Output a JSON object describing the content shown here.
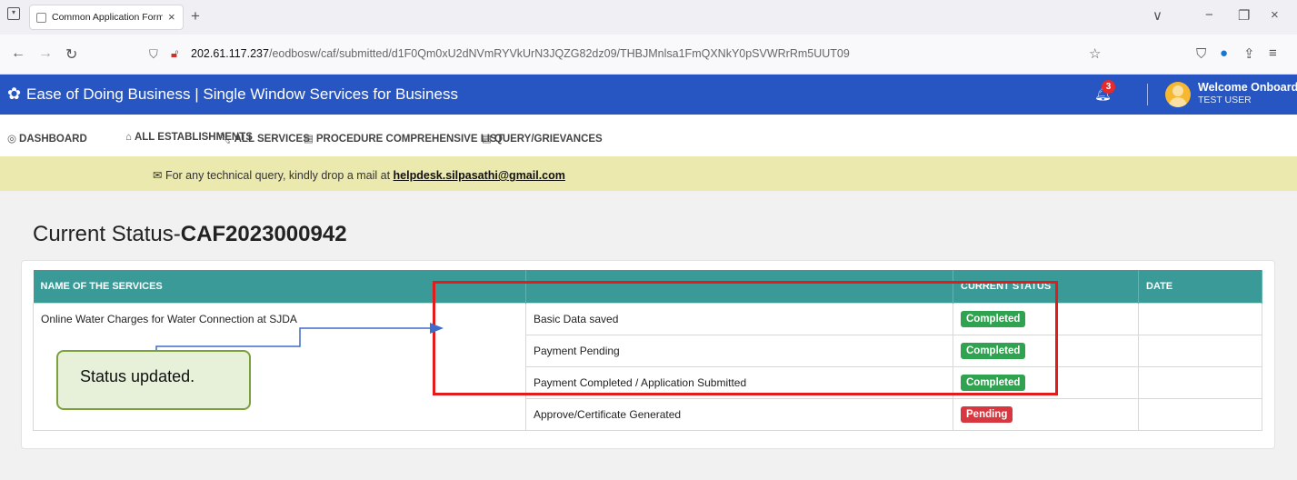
{
  "browser": {
    "tab_title": "Common Application Form Preview",
    "tab_close": "×",
    "new_tab": "+",
    "url_host": "202.61.117.237",
    "url_path": "/eodbosw/caf/submitted/d1F0Qm0xU2dNVmRYVkUrN3JQZG82dz09/THBJMnlsa1FmQXNkY0pSVWRrRm5UUT09",
    "win_controls": [
      "∨",
      "−",
      "❐",
      "×"
    ]
  },
  "header": {
    "title": "Ease of Doing Business | Single Window Services for Business",
    "notification_count": "3",
    "welcome": "Welcome Onboard",
    "user": "TEST USER",
    "accent": "#2756c2"
  },
  "menu": [
    {
      "label": "DASHBOARD",
      "icon": "dashboard-icon"
    },
    {
      "label": "ALL ESTABLISHMENTS",
      "icon": "building-icon"
    },
    {
      "label": "ALL SERVICES",
      "icon": "wrench-icon"
    },
    {
      "label": "PROCEDURE COMPREHENSIVE LIST",
      "icon": "list-icon"
    },
    {
      "label": "QUERY/GRIEVANCES",
      "icon": "list-icon"
    }
  ],
  "notice": {
    "text": "For any technical query, kindly drop a mail at ",
    "email": "helpdesk.silpasathi@gmail.com"
  },
  "page": {
    "title_prefix": "Current Status-",
    "caf_id": "CAF2023000942"
  },
  "table": {
    "headers": [
      "NAME OF THE SERVICES",
      "",
      "CURRENT STATUS",
      "DATE"
    ],
    "service": "Online Water Charges for Water Connection at SJDA",
    "rows": [
      {
        "step": "Basic Data saved",
        "status": "Completed",
        "date": ""
      },
      {
        "step": "Payment Pending",
        "status": "Completed",
        "date": ""
      },
      {
        "step": "Payment Completed / Application Submitted",
        "status": "Completed",
        "date": ""
      },
      {
        "step": "Approve/Certificate Generated",
        "status": "Pending",
        "date": ""
      }
    ],
    "status_colors": {
      "Completed": "#2fa34f",
      "Pending": "#d8373f"
    }
  },
  "annotation": {
    "callout_text": "Status updated."
  }
}
